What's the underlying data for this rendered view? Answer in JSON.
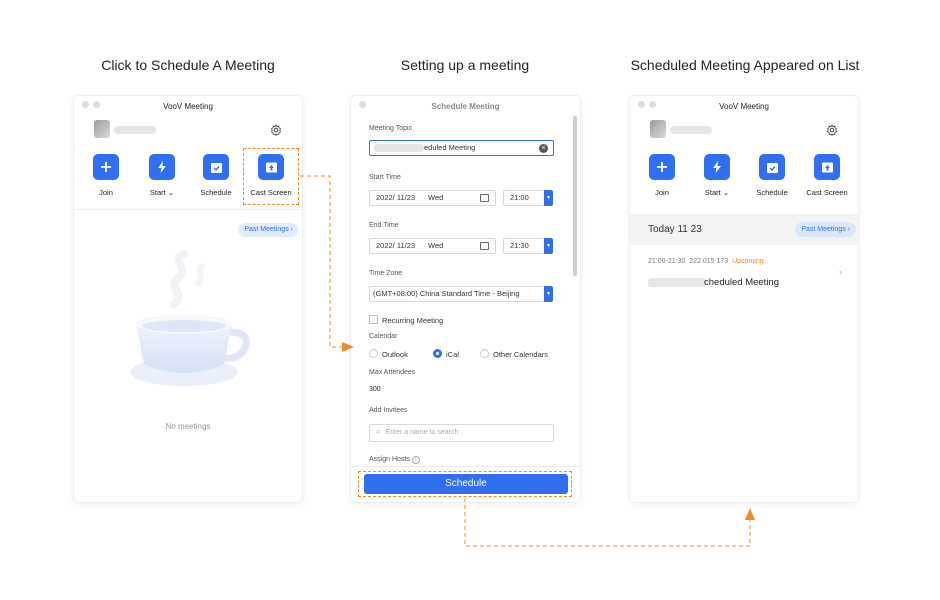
{
  "headings": [
    "Click to Schedule A Meeting",
    "Setting up a meeting",
    "Scheduled Meeting Appeared on List"
  ],
  "panel1": {
    "title": "VooV Meeting",
    "actions": [
      {
        "label": "Join",
        "icon": "plus-icon"
      },
      {
        "label": "Start",
        "icon": "lightning-icon"
      },
      {
        "label": "Schedule",
        "icon": "calendar-icon"
      },
      {
        "label": "Cast Screen",
        "icon": "cast-screen-icon"
      }
    ],
    "past_meetings": "Past Meetings",
    "empty_text": "No meetings"
  },
  "panel2": {
    "title": "Schedule Meeting",
    "topic_label": "Meeting Topic",
    "topic_value": "eduled Meeting",
    "start_label": "Start Time",
    "start_date": "2022/ 11/23",
    "start_day": "Wed",
    "start_time": "21:00",
    "end_label": "End Time",
    "end_date": "2022/ 11/23",
    "end_day": "Wed",
    "end_time": "21:30",
    "tz_label": "Time Zone",
    "tz_value": "(GMT+08:00) China Standard Time - Beijing",
    "recurring_label": "Recurring Meeting",
    "calendar_label": "Calendar",
    "calendar_options": [
      "Outlook",
      "iCal",
      "Other Calendars"
    ],
    "calendar_selected": "iCal",
    "max_label": "Max Attendees",
    "max_value": "300",
    "invitees_label": "Add Invitees",
    "invitees_placeholder": "Enter a name to search",
    "hosts_label": "Assign Hosts",
    "schedule_button": "Schedule"
  },
  "panel3": {
    "title": "VooV Meeting",
    "actions": [
      {
        "label": "Join",
        "icon": "plus-icon"
      },
      {
        "label": "Start",
        "icon": "lightning-icon"
      },
      {
        "label": "Schedule",
        "icon": "calendar-icon"
      },
      {
        "label": "Cast Screen",
        "icon": "cast-screen-icon"
      }
    ],
    "today": "Today  11 23",
    "past_meetings": "Past Meetings",
    "meeting_time": "21:00-21:30",
    "meeting_id": "222 015 173",
    "meeting_status": "Upcoming",
    "meeting_title": "cheduled Meeting"
  },
  "colors": {
    "accent": "#2f6ff0",
    "highlight": "#f08a24",
    "status_upcoming": "#f08a24"
  }
}
